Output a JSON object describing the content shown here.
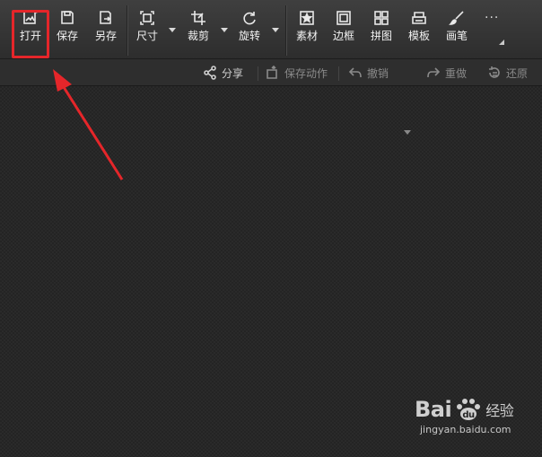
{
  "toolbar": {
    "open": "打开",
    "save": "保存",
    "save_as": "另存",
    "size": "尺寸",
    "crop": "裁剪",
    "rotate": "旋转",
    "material": "素材",
    "border": "边框",
    "puzzle": "拼图",
    "template": "模板",
    "brush": "画笔",
    "more": "···"
  },
  "subbar": {
    "share": "分享",
    "save_action": "保存动作",
    "undo": "撤销",
    "redo": "重做",
    "restore": "还原"
  },
  "watermark": {
    "logo_left": "Bai",
    "logo_right": "经验",
    "url": "jingyan.baidu.com"
  },
  "colors": {
    "highlight": "#e5262a",
    "canvas": "#242424",
    "toolbar": "#383838"
  }
}
